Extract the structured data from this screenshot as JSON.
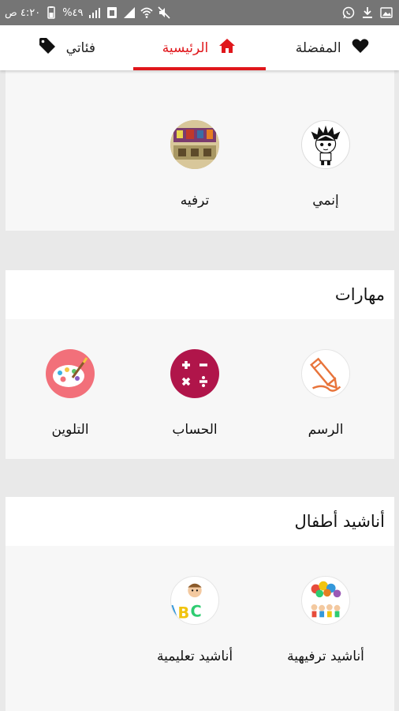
{
  "status_bar": {
    "time": "٤:٢٠ ص",
    "battery": "%٤٩"
  },
  "tabs": [
    {
      "label": "المفضلة",
      "icon": "heart-icon"
    },
    {
      "label": "الرئيسية",
      "icon": "home-icon",
      "active": true
    },
    {
      "label": "فئاتي",
      "icon": "tag-icon"
    }
  ],
  "accent_color": "#e0161b",
  "sections": [
    {
      "title": "",
      "items": [
        {
          "label": "إنمي",
          "icon": "anime-boy-thumbnail"
        },
        {
          "label": "ترفيه",
          "icon": "entertainment-collage-thumbnail"
        }
      ]
    },
    {
      "title": "مهارات",
      "items": [
        {
          "label": "الرسم",
          "icon": "pencil-drawing-icon"
        },
        {
          "label": "الحساب",
          "icon": "math-operators-icon"
        },
        {
          "label": "التلوين",
          "icon": "paint-palette-icon"
        }
      ]
    },
    {
      "title": "أناشيد أطفال",
      "items": [
        {
          "label": "أناشيد ترفيهية",
          "icon": "kids-balloons-thumbnail"
        },
        {
          "label": "أناشيد تعليمية",
          "icon": "abc-kid-thumbnail"
        }
      ]
    }
  ]
}
